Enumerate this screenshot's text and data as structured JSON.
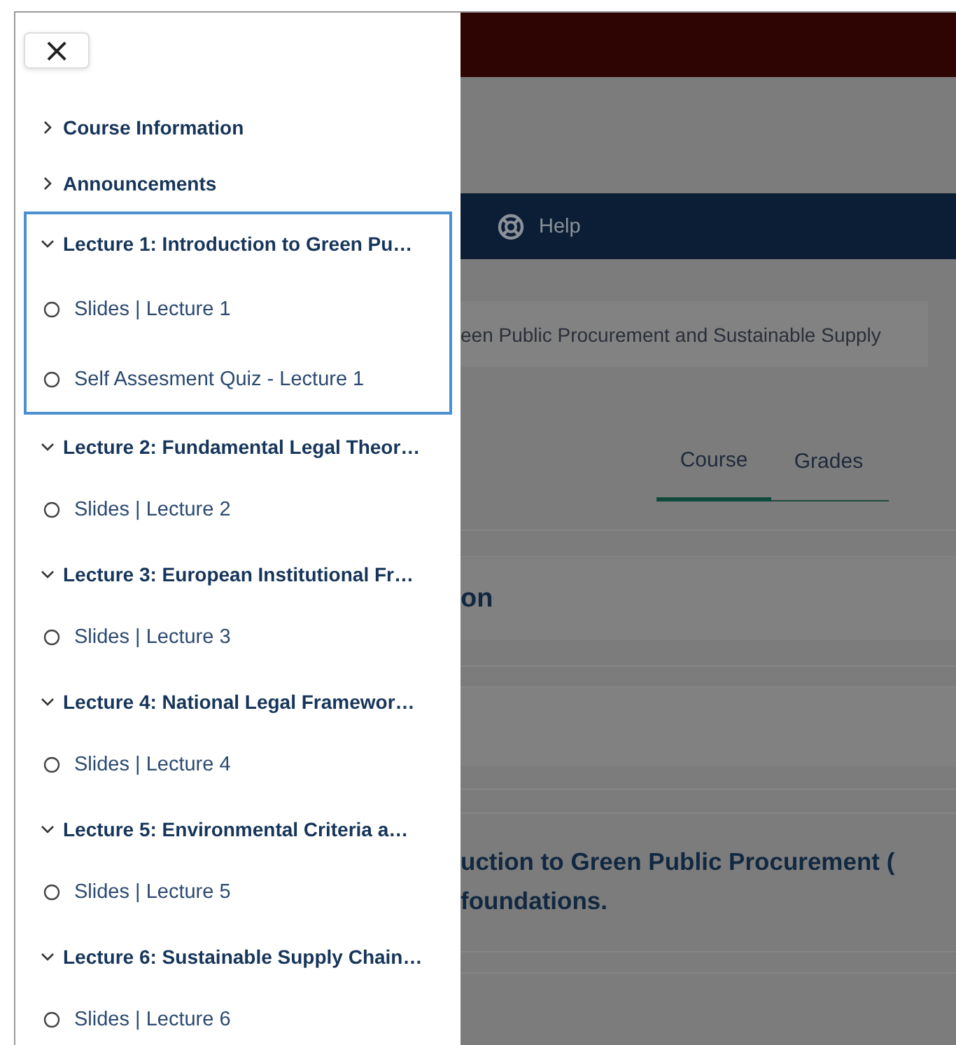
{
  "drawer": {
    "close_label": "×",
    "sections": [
      {
        "title": "Course Information",
        "expanded": false,
        "focused": false
      },
      {
        "title": "Announcements",
        "expanded": false,
        "focused": false
      },
      {
        "title": "Lecture 1: Introduction to Green Pu…",
        "expanded": true,
        "focused": true,
        "items": [
          {
            "label": "Slides | Lecture 1",
            "completed": false
          },
          {
            "label": "Self Assesment Quiz - Lecture 1",
            "completed": false
          }
        ]
      },
      {
        "title": "Lecture 2: Fundamental Legal Theor…",
        "expanded": true,
        "focused": false,
        "items": [
          {
            "label": "Slides | Lecture 2",
            "completed": false
          }
        ]
      },
      {
        "title": "Lecture 3: European Institutional Fr…",
        "expanded": true,
        "focused": false,
        "items": [
          {
            "label": "Slides | Lecture 3",
            "completed": false
          }
        ]
      },
      {
        "title": "Lecture 4: National Legal Framewor…",
        "expanded": true,
        "focused": false,
        "items": [
          {
            "label": "Slides | Lecture 4",
            "completed": false
          }
        ]
      },
      {
        "title": "Lecture 5: Environmental Criteria a…",
        "expanded": true,
        "focused": false,
        "items": [
          {
            "label": "Slides | Lecture 5",
            "completed": false
          }
        ]
      },
      {
        "title": "Lecture 6: Sustainable Supply Chain…",
        "expanded": true,
        "focused": false,
        "items": [
          {
            "label": "Slides | Lecture 6",
            "completed": false
          }
        ]
      }
    ]
  },
  "background": {
    "nav": {
      "help_label": "Help"
    },
    "breadcrumb": "een Public Procurement and Sustainable Supply",
    "tabs": [
      {
        "label": "Course",
        "selected": true
      },
      {
        "label": "Grades",
        "selected": false
      }
    ],
    "section_heading": "on",
    "lecture_heading": [
      "uction to Green Public Procurement (",
      "foundations."
    ]
  }
}
